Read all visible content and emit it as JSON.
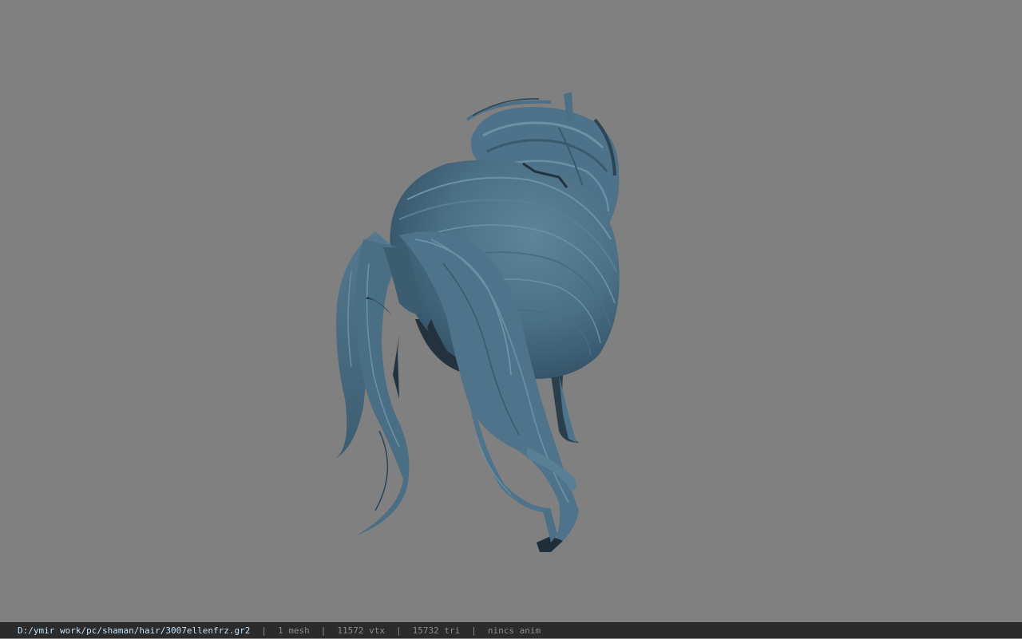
{
  "viewport": {
    "background_color": "#808080",
    "model": {
      "name": "hair-model",
      "color": "#4b6f85",
      "shade_color": "#3a5a6e",
      "highlight_color": "#6a8ea4",
      "dark_color": "#1f2e38"
    }
  },
  "statusbar": {
    "file_path": "D:/ymir work/pc/shaman/hair/3007ellenfrz.gr2",
    "separator": "|",
    "mesh_count": "1 mesh",
    "vertex_count": "11572 vtx",
    "triangle_count": "15732 tri",
    "anim_status": "nincs anim",
    "background_color": "#2b2b2b",
    "path_color": "#bfe3ff",
    "text_color": "#8c8c8c"
  }
}
